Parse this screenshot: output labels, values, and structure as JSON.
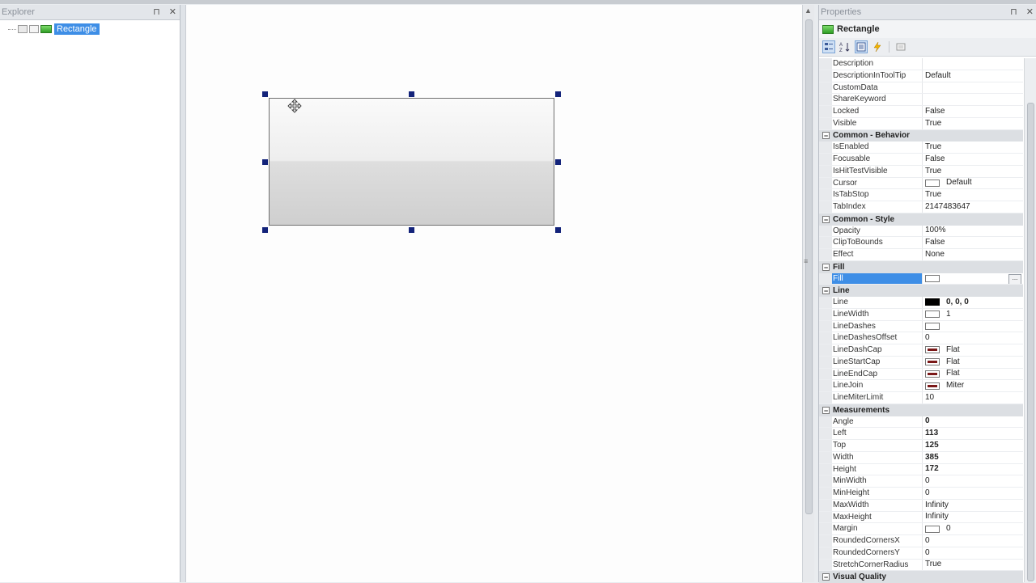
{
  "explorer": {
    "title": "Explorer",
    "pin": "⊓",
    "close": "✕",
    "tree_item": "Rectangle"
  },
  "properties": {
    "title": "Properties",
    "pin": "⊓",
    "close": "✕",
    "object_name": "Rectangle",
    "rows": [
      {
        "type": "prop",
        "name": "Description",
        "value": ""
      },
      {
        "type": "prop",
        "name": "DescriptionInToolTip",
        "value": "Default"
      },
      {
        "type": "prop",
        "name": "CustomData",
        "value": ""
      },
      {
        "type": "prop",
        "name": "ShareKeyword",
        "value": ""
      },
      {
        "type": "prop",
        "name": "Locked",
        "value": "False"
      },
      {
        "type": "prop",
        "name": "Visible",
        "value": "True"
      },
      {
        "type": "cat",
        "name": "Common - Behavior",
        "toggle": "−"
      },
      {
        "type": "prop",
        "name": "IsEnabled",
        "value": "True"
      },
      {
        "type": "prop",
        "name": "Focusable",
        "value": "False"
      },
      {
        "type": "prop",
        "name": "IsHitTestVisible",
        "value": "True"
      },
      {
        "type": "prop",
        "name": "Cursor",
        "value": "Default",
        "swatch": "white"
      },
      {
        "type": "prop",
        "name": "IsTabStop",
        "value": "True"
      },
      {
        "type": "prop",
        "name": "TabIndex",
        "value": "2147483647"
      },
      {
        "type": "cat",
        "name": "Common - Style",
        "toggle": "−"
      },
      {
        "type": "prop",
        "name": "Opacity",
        "value": "100%"
      },
      {
        "type": "prop",
        "name": "ClipToBounds",
        "value": "False"
      },
      {
        "type": "prop",
        "name": "Effect",
        "value": "None"
      },
      {
        "type": "cat",
        "name": "Fill",
        "toggle": "−"
      },
      {
        "type": "prop",
        "name": "Fill",
        "value": "",
        "swatch": "white",
        "selected": true,
        "ellipsis": "..."
      },
      {
        "type": "cat",
        "name": "Line",
        "toggle": "−"
      },
      {
        "type": "prop",
        "name": "Line",
        "value": "0, 0, 0",
        "swatch": "black",
        "bold": true
      },
      {
        "type": "prop",
        "name": "LineWidth",
        "value": "1",
        "swatch": "white"
      },
      {
        "type": "prop",
        "name": "LineDashes",
        "value": "",
        "swatch": "white"
      },
      {
        "type": "prop",
        "name": "LineDashesOffset",
        "value": "0"
      },
      {
        "type": "prop",
        "name": "LineDashCap",
        "value": "Flat",
        "swatch": "cap"
      },
      {
        "type": "prop",
        "name": "LineStartCap",
        "value": "Flat",
        "swatch": "cap"
      },
      {
        "type": "prop",
        "name": "LineEndCap",
        "value": "Flat",
        "swatch": "cap"
      },
      {
        "type": "prop",
        "name": "LineJoin",
        "value": "Miter",
        "swatch": "cap"
      },
      {
        "type": "prop",
        "name": "LineMiterLimit",
        "value": "10"
      },
      {
        "type": "cat",
        "name": "Measurements",
        "toggle": "−"
      },
      {
        "type": "prop",
        "name": "Angle",
        "value": "0",
        "bold": true
      },
      {
        "type": "prop",
        "name": "Left",
        "value": "113",
        "bold": true
      },
      {
        "type": "prop",
        "name": "Top",
        "value": "125",
        "bold": true
      },
      {
        "type": "prop",
        "name": "Width",
        "value": "385",
        "bold": true
      },
      {
        "type": "prop",
        "name": "Height",
        "value": "172",
        "bold": true
      },
      {
        "type": "prop",
        "name": "MinWidth",
        "value": "0"
      },
      {
        "type": "prop",
        "name": "MinHeight",
        "value": "0"
      },
      {
        "type": "prop",
        "name": "MaxWidth",
        "value": "Infinity"
      },
      {
        "type": "prop",
        "name": "MaxHeight",
        "value": "Infinity"
      },
      {
        "type": "prop",
        "name": "Margin",
        "value": "0",
        "swatch": "white"
      },
      {
        "type": "prop",
        "name": "RoundedCornersX",
        "value": "0"
      },
      {
        "type": "prop",
        "name": "RoundedCornersY",
        "value": "0"
      },
      {
        "type": "prop",
        "name": "StretchCornerRadius",
        "value": "True"
      },
      {
        "type": "cat",
        "name": "Visual Quality",
        "toggle": "−"
      }
    ]
  },
  "colors": {
    "selection": "#3e8ee6",
    "handle": "#13237a",
    "panel_header": "#e3e6ea"
  }
}
